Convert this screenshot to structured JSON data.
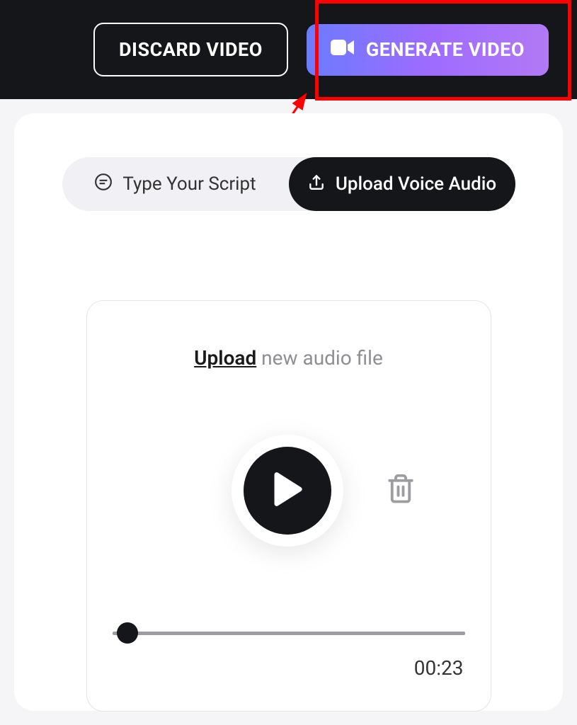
{
  "header": {
    "discard_label": "DISCARD VIDEO",
    "generate_label": "GENERATE VIDEO"
  },
  "tabs": {
    "script_label": "Type Your Script",
    "upload_label": "Upload Voice Audio"
  },
  "audio": {
    "upload_link": "Upload",
    "upload_rest": " new audio file",
    "time": "00:23"
  },
  "annotation": {
    "highlight_color": "#ff0000"
  }
}
